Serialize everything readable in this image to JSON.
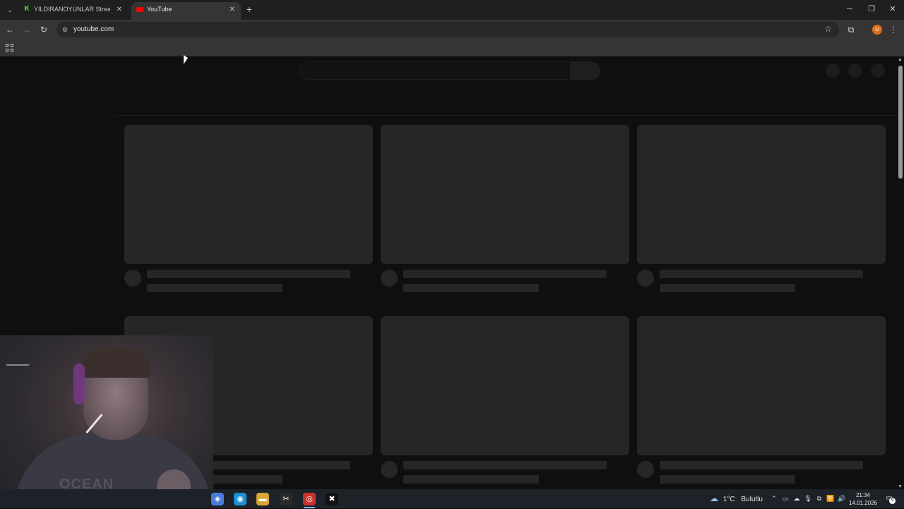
{
  "browser": {
    "tabs": [
      {
        "title": "YILDIRANOYUNLAR Stream - W",
        "favicon": "kick-logo-icon",
        "active": false
      },
      {
        "title": "YouTube",
        "favicon": "youtube-logo-icon",
        "active": true
      }
    ],
    "tab_menu_icon": "chevron-down-icon",
    "close_glyph": "✕",
    "new_tab_glyph": "+",
    "window_controls": {
      "minimize": "─",
      "restore": "❐",
      "close": "✕"
    },
    "toolbar": {
      "back": "←",
      "forward": "→",
      "reload": "↻",
      "site_info": "⚙",
      "url": "youtube.com",
      "bookmark_star": "☆",
      "extensions": "⧉",
      "profile_initial": "U",
      "menu": "⋮"
    },
    "bookmarks_bar": {
      "apps_icon": "apps-grid-icon"
    },
    "colors": {
      "tab_strip": "#1f1f1f",
      "toolbar": "#353535",
      "profile": "#e06c15",
      "page_bg": "#0f0f0f",
      "skeleton": "#262626"
    }
  },
  "youtube_page": {
    "state": "loading-skeleton",
    "rows": 2,
    "columns": 3
  },
  "webcam": {
    "shirt_text": "OCEAN"
  },
  "taskbar": {
    "apps": [
      {
        "name": "copilot-icon",
        "glyph": "◈",
        "color": "#4a7bd8"
      },
      {
        "name": "edge-icon",
        "glyph": "◉",
        "color": "#1b8fd4"
      },
      {
        "name": "file-explorer-icon",
        "glyph": "▬",
        "color": "#d7a536"
      },
      {
        "name": "capcut-icon",
        "glyph": "✂",
        "color": "#2a2a2a"
      },
      {
        "name": "recorder-icon",
        "glyph": "◎",
        "color": "#c8312b"
      },
      {
        "name": "capcut-alt-icon",
        "glyph": "✖",
        "color": "#111111"
      }
    ],
    "weather": {
      "temp": "1°C",
      "condition": "Bulutlu"
    },
    "tray": {
      "chevron": "⌃",
      "icons": [
        "▭",
        "☁",
        "🎙",
        "⧉",
        "🛜",
        "🔊"
      ]
    },
    "clock": {
      "time": "21:34",
      "date": "14.01.2026"
    },
    "notification_count": "9"
  }
}
